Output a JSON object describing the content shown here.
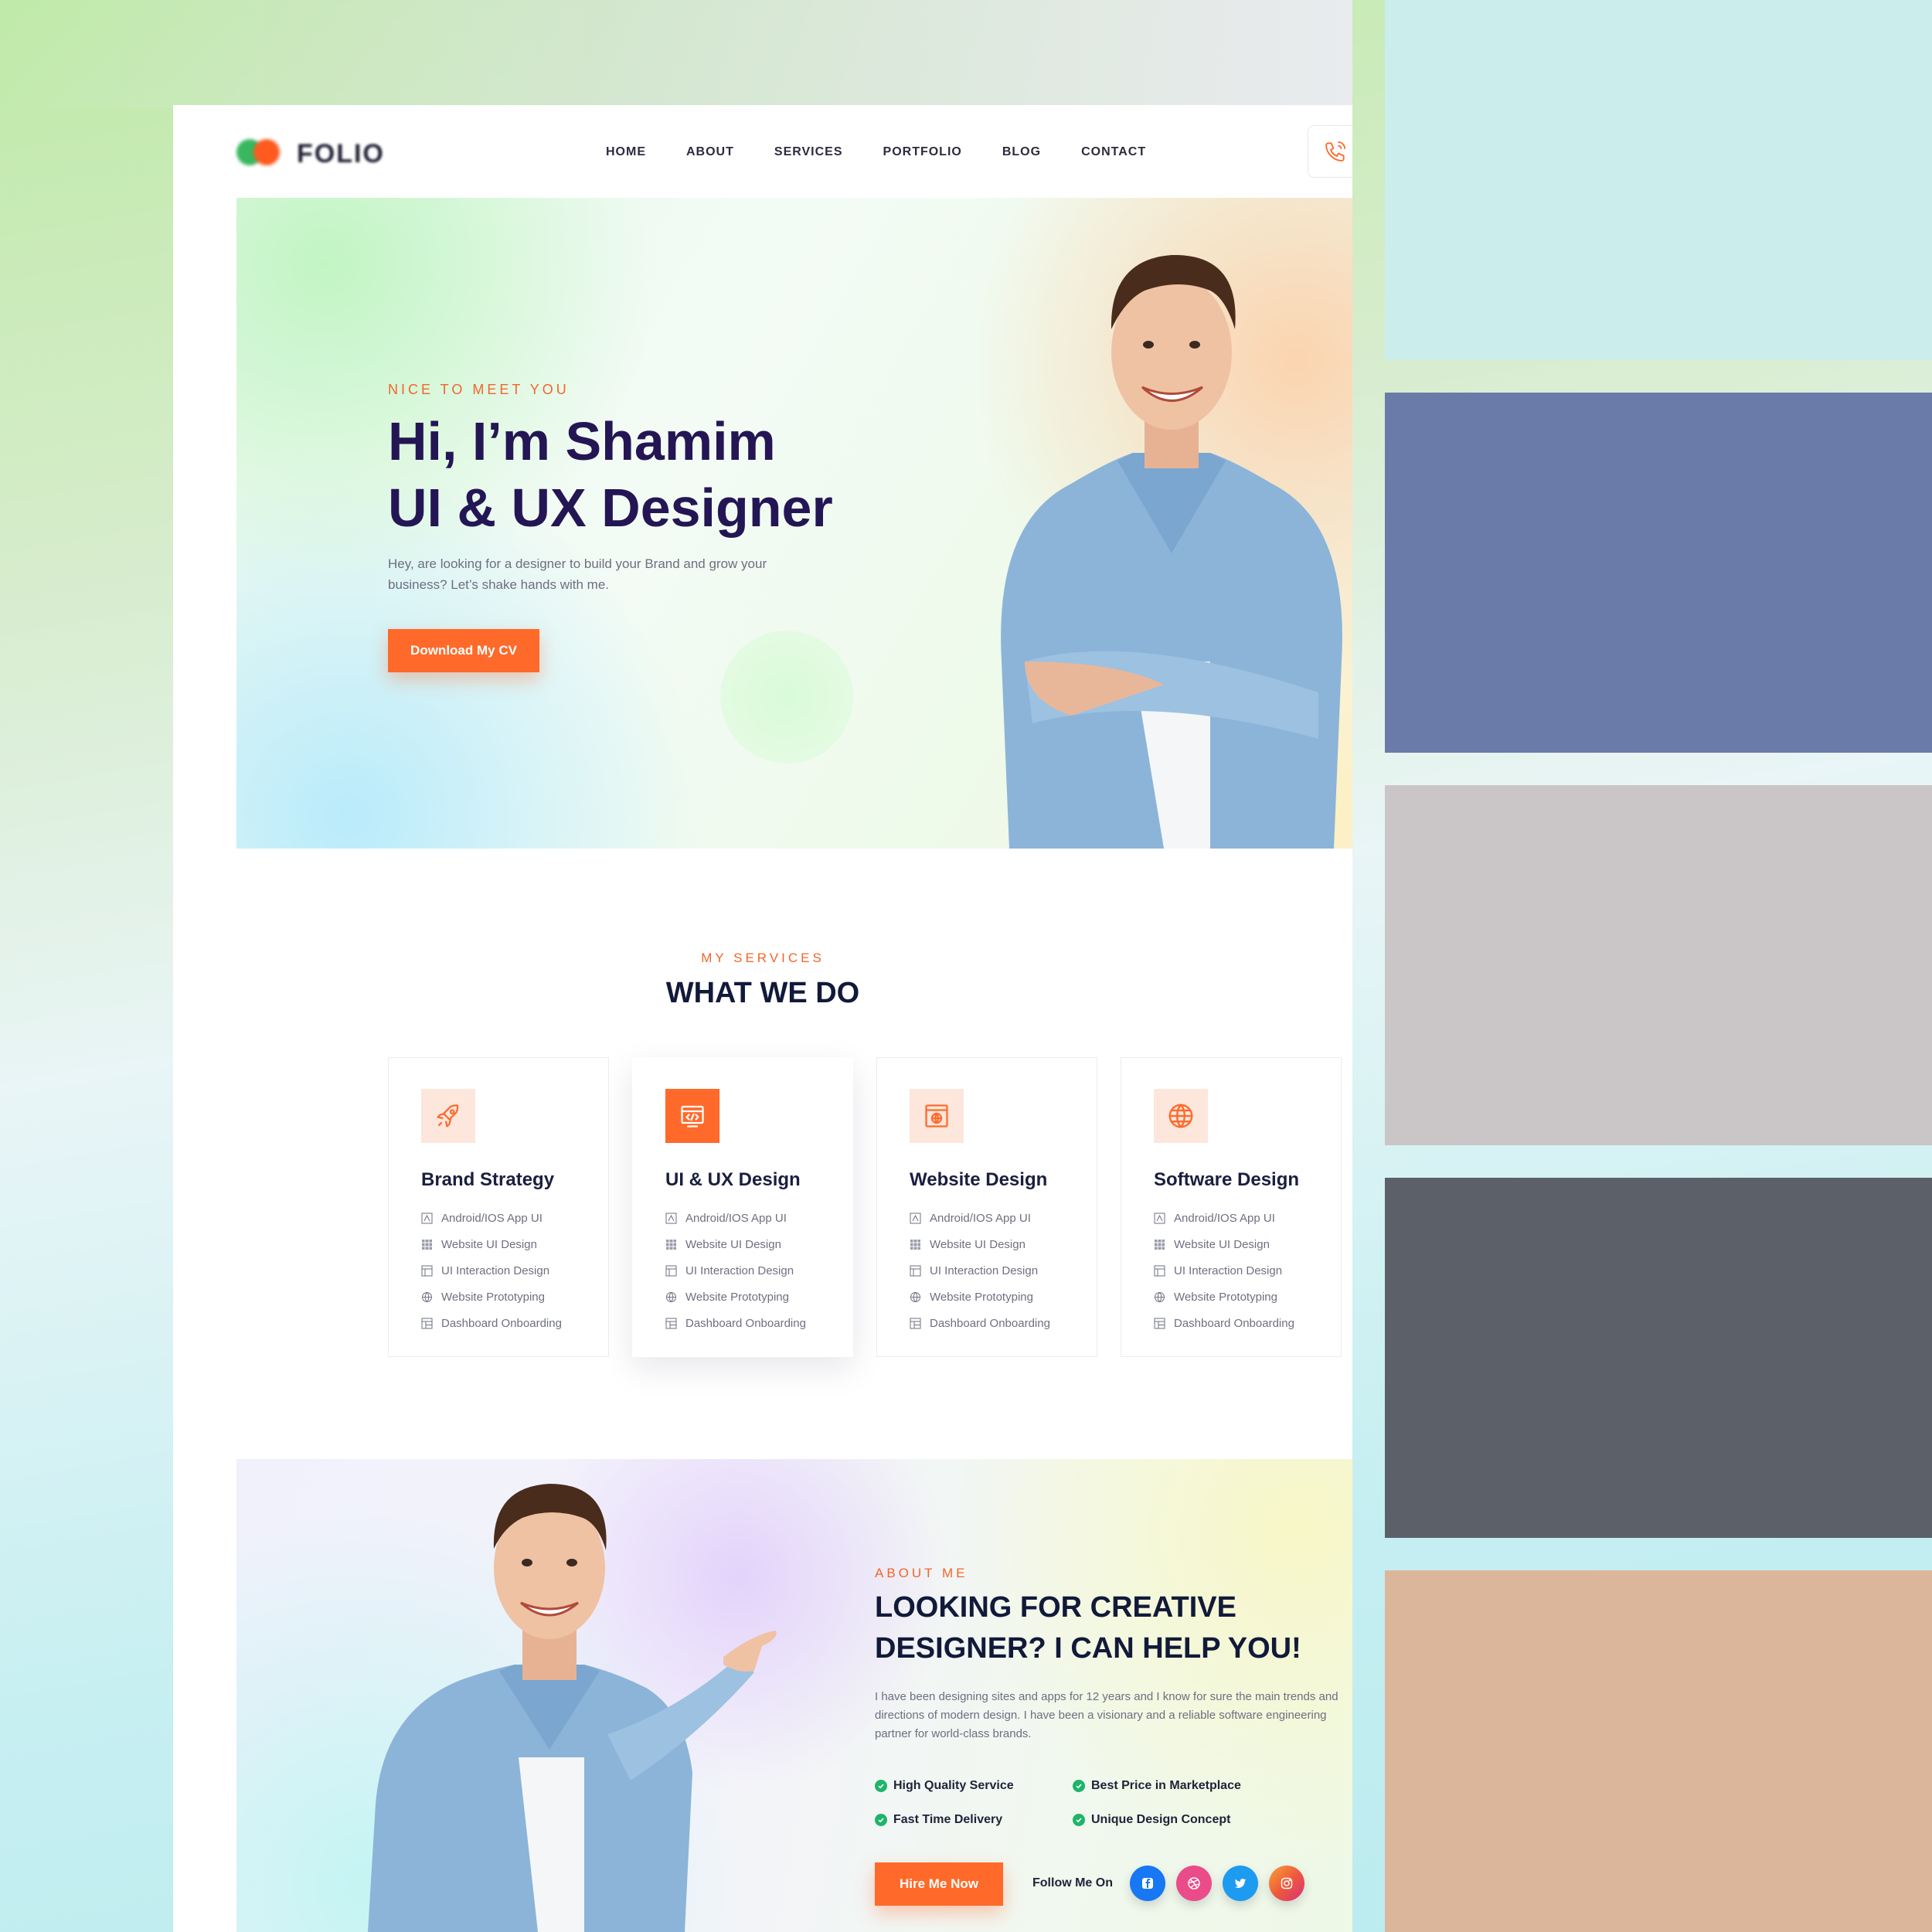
{
  "palette": [
    "#cbeeed",
    "#6b7ba9",
    "#cac5c6",
    "#5b6069",
    "#dcb69b"
  ],
  "logo": {
    "text": "FOLIO",
    "dot_colors": [
      "#39b760",
      "#ff5a1f"
    ]
  },
  "nav": {
    "items": [
      "HOME",
      "ABOUT",
      "SERVICES",
      "PORTFOLIO",
      "BLOG",
      "CONTACT"
    ],
    "phone_icon": "phone-icon"
  },
  "hero": {
    "kicker": "NICE TO MEET YOU",
    "title_line1": "Hi, I’m Shamim",
    "title_line2": "UI & UX Designer",
    "description": "Hey, are looking for a designer to build your Brand and grow your business? Let’s shake hands with me.",
    "button": "Download My CV"
  },
  "services": {
    "kicker": "MY SERVICES",
    "title": "WHAT WE DO",
    "cards": [
      {
        "title": "Brand Strategy",
        "icon": "rocket-icon",
        "active": false,
        "items": [
          "Android/IOS App UI",
          "Website UI Design",
          "UI Interaction Design",
          "Website Prototyping",
          "Dashboard Onboarding"
        ]
      },
      {
        "title": "UI & UX Design",
        "icon": "code-window-icon",
        "active": true,
        "items": [
          "Android/IOS App UI",
          "Website UI Design",
          "UI Interaction Design",
          "Website Prototyping",
          "Dashboard Onboarding"
        ]
      },
      {
        "title": "Website Design",
        "icon": "web-globe-icon",
        "active": false,
        "items": [
          "Android/IOS App UI",
          "Website UI Design",
          "UI Interaction Design",
          "Website Prototyping",
          "Dashboard Onboarding"
        ]
      },
      {
        "title": "Software Design",
        "icon": "globe-icon",
        "active": false,
        "items": [
          "Android/IOS App UI",
          "Website UI Design",
          "UI Interaction Design",
          "Website Prototyping",
          "Dashboard Onboarding"
        ]
      }
    ]
  },
  "about": {
    "kicker": "ABOUT ME",
    "title_line1": "LOOKING FOR CREATIVE",
    "title_line2": "DESIGNER? I CAN HELP YOU!",
    "description": "I have been designing sites and apps for 12 years and I know for sure the main trends and directions of modern design. I have been a visionary and a reliable software engineering partner for world-class brands.",
    "features": [
      "High Quality Service",
      "Best Price in Marketplace",
      "Fast Time Delivery",
      "Unique Design Concept"
    ],
    "button": "Hire Me Now",
    "follow_label": "Follow Me On",
    "socials": [
      {
        "name": "facebook-icon",
        "color": "#1877f2"
      },
      {
        "name": "dribbble-icon",
        "color": "#ea4c89"
      },
      {
        "name": "twitter-icon",
        "color": "#1d9bf0"
      },
      {
        "name": "instagram-icon",
        "color": "#ee5a3b"
      }
    ]
  },
  "colors": {
    "accent": "#ff6a2a",
    "heading": "#241654",
    "check": "#1fb46a"
  }
}
